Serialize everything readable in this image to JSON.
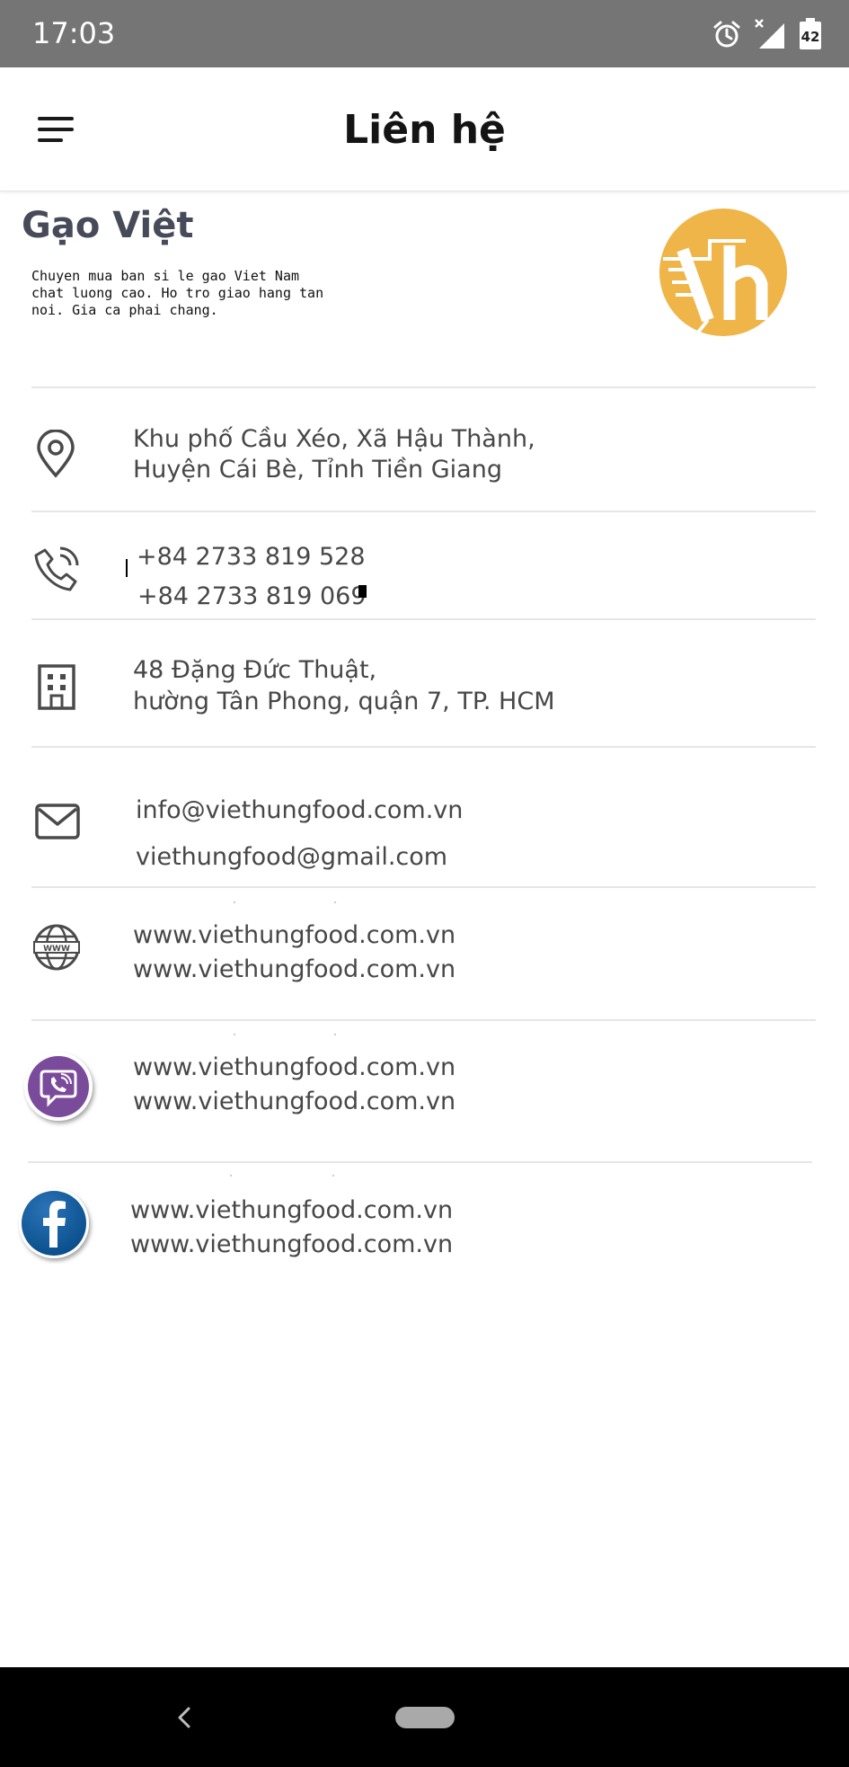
{
  "status_bar": {
    "time": "17:03",
    "battery_level": "42",
    "icons": [
      "alarm-icon",
      "signal-icon",
      "battery-icon"
    ]
  },
  "app_bar": {
    "title": "Liên hệ",
    "menu_icon": "hamburger-menu-icon"
  },
  "brand": {
    "name": "Gạo Việt",
    "tagline": "Chuyen mua ban si le gao Viet Nam\nchat luong cao. Ho tro giao hang tan\nnoi. Gia ca phai chang.",
    "logo_color": "#efb548"
  },
  "contact": {
    "address": {
      "icon": "location-pin-icon",
      "line1": "Khu phố Cầu Xéo, Xã Hậu Thành,",
      "line2": "Huyện Cái Bè, Tỉnh Tiền Giang"
    },
    "phone": {
      "icon": "phone-icon",
      "line1": "+84 2733 819 528",
      "line2": "+84 2733 819 069"
    },
    "office": {
      "icon": "building-icon",
      "line1": "48 Đặng Đức Thuật,",
      "line2": "hường Tân Phong, quận 7, TP. HCM"
    },
    "email": {
      "icon": "mail-icon",
      "line1": "info@viethungfood.com.vn",
      "line2": "viethungfood@gmail.com"
    },
    "website": {
      "icon": "globe-www-icon",
      "line1": "www.viethungfood.com.vn",
      "line2": "www.viethungfood.com.vn"
    },
    "viber": {
      "icon": "viber-icon",
      "color": "#7b4b9b",
      "line1": "www.viethungfood.com.vn",
      "line2": "www.viethungfood.com.vn"
    },
    "facebook": {
      "icon": "facebook-icon",
      "color": "#0b4f8c",
      "line1": "www.viethungfood.com.vn",
      "line2": "www.viethungfood.com.vn"
    }
  },
  "nav_bar": {
    "back_icon": "back-chevron-icon",
    "home_icon": "home-pill-icon"
  }
}
